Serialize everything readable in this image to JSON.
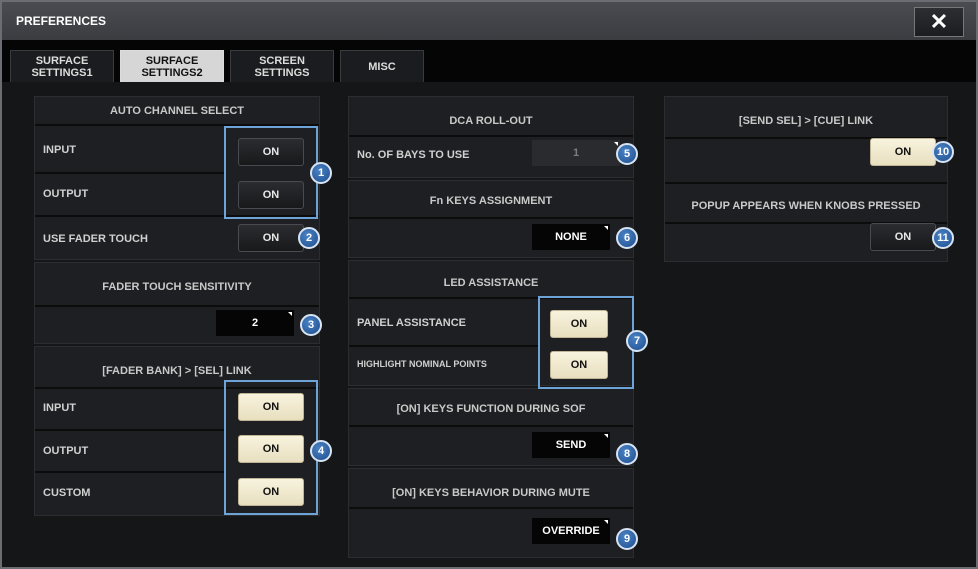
{
  "window": {
    "title": "PREFERENCES",
    "close_label": "✕"
  },
  "tabs": [
    {
      "label": "SURFACE\nSETTINGS1",
      "active": false
    },
    {
      "label": "SURFACE\nSETTINGS2",
      "active": true
    },
    {
      "label": "SCREEN\nSETTINGS",
      "active": false
    },
    {
      "label": "MISC",
      "active": false
    }
  ],
  "auto_channel_select": {
    "header": "AUTO CHANNEL SELECT",
    "rows": [
      {
        "label": "INPUT",
        "button": "ON",
        "state": "off"
      },
      {
        "label": "OUTPUT",
        "button": "ON",
        "state": "off"
      },
      {
        "label": "USE FADER TOUCH",
        "button": "ON",
        "state": "off"
      }
    ]
  },
  "fader_touch_sensitivity": {
    "header": "FADER TOUCH SENSITIVITY",
    "value": "2"
  },
  "fader_bank_sel_link": {
    "header": "[FADER BANK] > [SEL] LINK",
    "rows": [
      {
        "label": "INPUT",
        "button": "ON",
        "state": "on"
      },
      {
        "label": "OUTPUT",
        "button": "ON",
        "state": "on"
      },
      {
        "label": "CUSTOM",
        "button": "ON",
        "state": "on"
      }
    ]
  },
  "dca_roll_out": {
    "header": "DCA ROLL-OUT",
    "label": "No. OF BAYS TO USE",
    "value": "1"
  },
  "fn_keys_assignment": {
    "header": "Fn KEYS ASSIGNMENT",
    "value": "NONE"
  },
  "led_assistance": {
    "header": "LED ASSISTANCE",
    "rows": [
      {
        "label": "PANEL ASSISTANCE",
        "button": "ON",
        "state": "on"
      },
      {
        "label": "HIGHLIGHT NOMINAL POINTS",
        "button": "ON",
        "state": "on"
      }
    ]
  },
  "on_keys_function_sof": {
    "header": "[ON] KEYS FUNCTION DURING SOF",
    "value": "SEND"
  },
  "on_keys_behavior_mute": {
    "header": "[ON] KEYS BEHAVIOR DURING MUTE",
    "value": "OVERRIDE"
  },
  "send_sel_cue_link": {
    "header": "[SEND SEL] > [CUE] LINK",
    "button": "ON",
    "state": "on"
  },
  "popup_knobs": {
    "header": "POPUP APPEARS WHEN KNOBS PRESSED",
    "button": "ON",
    "state": "off"
  },
  "callouts": [
    "1",
    "2",
    "3",
    "4",
    "5",
    "6",
    "7",
    "8",
    "9",
    "10",
    "11"
  ],
  "colors": {
    "callout": "#2f66a8",
    "highlight": "#6ea3d8",
    "button_on": "#f3edd4",
    "background": "#151618"
  }
}
